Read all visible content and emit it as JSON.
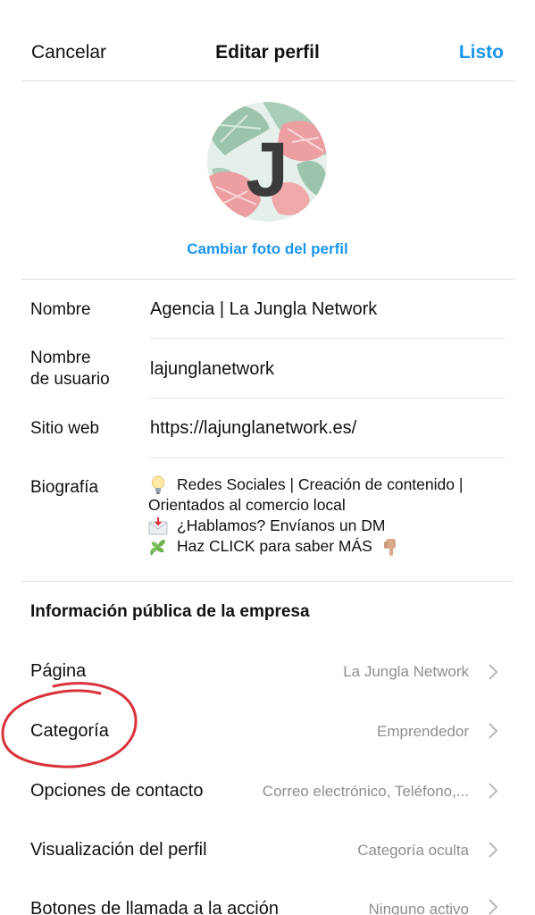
{
  "header": {
    "cancel_label": "Cancelar",
    "title": "Editar perfil",
    "done_label": "Listo"
  },
  "profile": {
    "avatar_letter": "J",
    "change_photo_label": "Cambiar foto del perfil"
  },
  "fields": {
    "name_label": "Nombre",
    "name_value": "Agencia | La Jungla Network",
    "username_label_1": "Nombre",
    "username_label_2": "de usuario",
    "username_value": "lajunglanetwork",
    "website_label": "Sitio web",
    "website_value": "https://lajunglanetwork.es/",
    "bio_label": "Biografía",
    "bio_lines": [
      "Redes Sociales | Creación de contenido |",
      "Orientados al comercio local",
      "¿Hablamos? Envíanos un DM",
      "Haz CLICK para saber MÁS"
    ]
  },
  "business": {
    "section_title": "Información pública de la empresa",
    "options": [
      {
        "label": "Página",
        "value": "La Jungla Network"
      },
      {
        "label": "Categoría",
        "value": "Emprendedor"
      },
      {
        "label": "Opciones de contacto",
        "value": "Correo electrónico, Teléfono,..."
      },
      {
        "label": "Visualización del perfil",
        "value": "Categoría oculta"
      },
      {
        "label": "Botones de llamada a la acción",
        "value": "Ninguno activo"
      }
    ]
  },
  "colors": {
    "accent": "#1a95ef",
    "annotation": "#d8323a",
    "secondary_text": "#8e8e8e"
  },
  "icons": [
    "lightbulb-emoji",
    "envelope-emoji",
    "herb-emoji",
    "pointing-down-emoji",
    "chevron-right-icon"
  ]
}
